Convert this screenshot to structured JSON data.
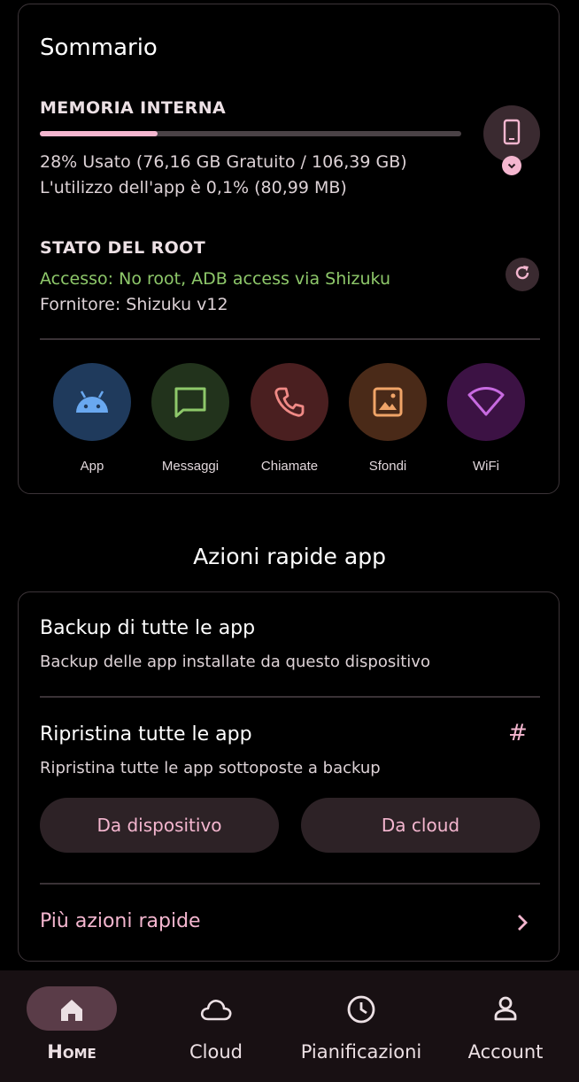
{
  "summary": {
    "title": "Sommario",
    "storage": {
      "label": "MEMORIA INTERNA",
      "used_fraction": 0.28,
      "usage_line": "28% Usato (76,16 GB Gratuito / 106,39 GB)",
      "app_usage_line": "L'utilizzo dell'app è 0,1% (80,99 MB)",
      "device_icon": "phone-icon",
      "expand_icon": "chevron-down-icon"
    },
    "root": {
      "label": "STATO DEL ROOT",
      "access_line": "Accesso: No root, ADB access via Shizuku",
      "provider_line": "Fornitore: Shizuku v12",
      "refresh_icon": "refresh-icon"
    },
    "quick_access": [
      {
        "label": "App",
        "icon": "android-icon",
        "bg": "#1f3a5c",
        "fg": "#69a8f0"
      },
      {
        "label": "Messaggi",
        "icon": "message-icon",
        "bg": "#22331c",
        "fg": "#8ec86a"
      },
      {
        "label": "Chiamate",
        "icon": "phone-call-icon",
        "bg": "#4a1f20",
        "fg": "#f08a86"
      },
      {
        "label": "Sfondi",
        "icon": "image-icon",
        "bg": "#4a2a18",
        "fg": "#f0a468"
      },
      {
        "label": "WiFi",
        "icon": "wifi-icon",
        "bg": "#3c1244",
        "fg": "#c76ae0"
      }
    ]
  },
  "quick_actions": {
    "section_title": "Azioni rapide app",
    "backup": {
      "title": "Backup di tutte le app",
      "subtitle": "Backup delle app installate da questo dispositivo"
    },
    "restore": {
      "title": "Ripristina tutte le app",
      "subtitle": "Ripristina tutte le app sottoposte a backup",
      "hash_icon": "#",
      "from_device": "Da dispositivo",
      "from_cloud": "Da cloud"
    },
    "more_label": "Più azioni rapide",
    "more_icon": "chevron-right-icon"
  },
  "bottom_nav": {
    "items": [
      {
        "label": "Home",
        "icon": "home-icon",
        "active": true
      },
      {
        "label": "Cloud",
        "icon": "cloud-icon",
        "active": false
      },
      {
        "label": "Pianificazioni",
        "icon": "clock-icon",
        "active": false
      },
      {
        "label": "Account",
        "icon": "person-icon",
        "active": false
      }
    ]
  },
  "colors": {
    "accent_pink": "#f4b6cf",
    "root_ok_green": "#8ec86a",
    "background": "#000000",
    "nav_background": "#181013"
  }
}
